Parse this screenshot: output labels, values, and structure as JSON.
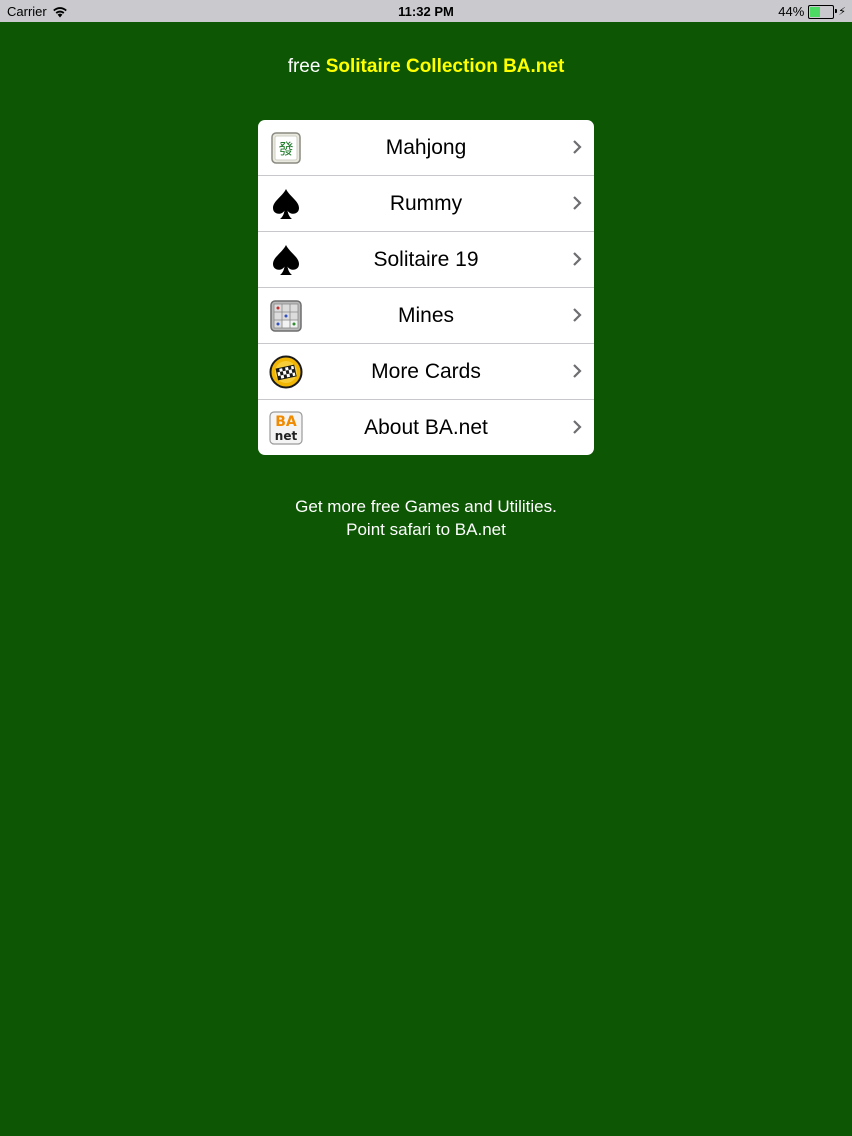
{
  "status_bar": {
    "carrier": "Carrier",
    "time": "11:32 PM",
    "battery": "44%",
    "battery_level": 0.44
  },
  "header": {
    "prefix": "free",
    "brand": "Solitaire Collection BA.net"
  },
  "menu": {
    "items": [
      {
        "label": "Mahjong",
        "icon": "mahjong-tile-icon"
      },
      {
        "label": "Rummy",
        "icon": "spade-icon"
      },
      {
        "label": "Solitaire 19",
        "icon": "spade-icon"
      },
      {
        "label": "Mines",
        "icon": "minesweeper-grid-icon"
      },
      {
        "label": "More Cards",
        "icon": "checkered-flag-icon"
      },
      {
        "label": "About BA.net",
        "icon": "ba-net-logo-icon",
        "logo_text": [
          "BA",
          "net"
        ]
      }
    ]
  },
  "footer": {
    "line1": "Get more free Games and Utilities.",
    "line2": "Point safari to BA.net"
  },
  "colors": {
    "background": "#0c5604",
    "brand": "#ffff00",
    "battery": "#4cd964"
  }
}
